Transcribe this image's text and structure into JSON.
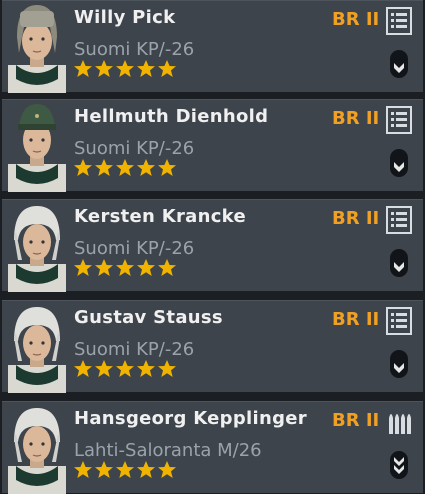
{
  "colors": {
    "accent": "#f0a023",
    "card_bg": "#3e444b",
    "name": "#f0f0f0",
    "weapon": "#9aa3ab",
    "star": "#f0b300"
  },
  "soldiers": [
    {
      "name": "Willy Pick",
      "weapon": "Suomi KP/-26",
      "br": "BR II",
      "stars": 5,
      "ammo_icon": "magazine-list-icon",
      "rank_icon": "rank-chevron-icon",
      "helmet": "fur-hat"
    },
    {
      "name": "Hellmuth Dienhold",
      "weapon": "Suomi KP/-26",
      "br": "BR II",
      "stars": 5,
      "ammo_icon": "magazine-list-icon",
      "rank_icon": "rank-chevron-icon",
      "helmet": "field-cap"
    },
    {
      "name": "Kersten Krancke",
      "weapon": "Suomi KP/-26",
      "br": "BR II",
      "stars": 5,
      "ammo_icon": "magazine-list-icon",
      "rank_icon": "rank-chevron-icon",
      "helmet": "white-helmet"
    },
    {
      "name": "Gustav Stauss",
      "weapon": "Suomi KP/-26",
      "br": "BR II",
      "stars": 5,
      "ammo_icon": "magazine-list-icon",
      "rank_icon": "rank-chevron-icon",
      "helmet": "white-helmet"
    },
    {
      "name": "Hansgeorg Kepplinger",
      "weapon": "Lahti-Saloranta M/26",
      "br": "BR II",
      "stars": 5,
      "ammo_icon": "bullets-icon",
      "rank_icon": "rank-chevrons-icon",
      "helmet": "white-helmet"
    }
  ]
}
